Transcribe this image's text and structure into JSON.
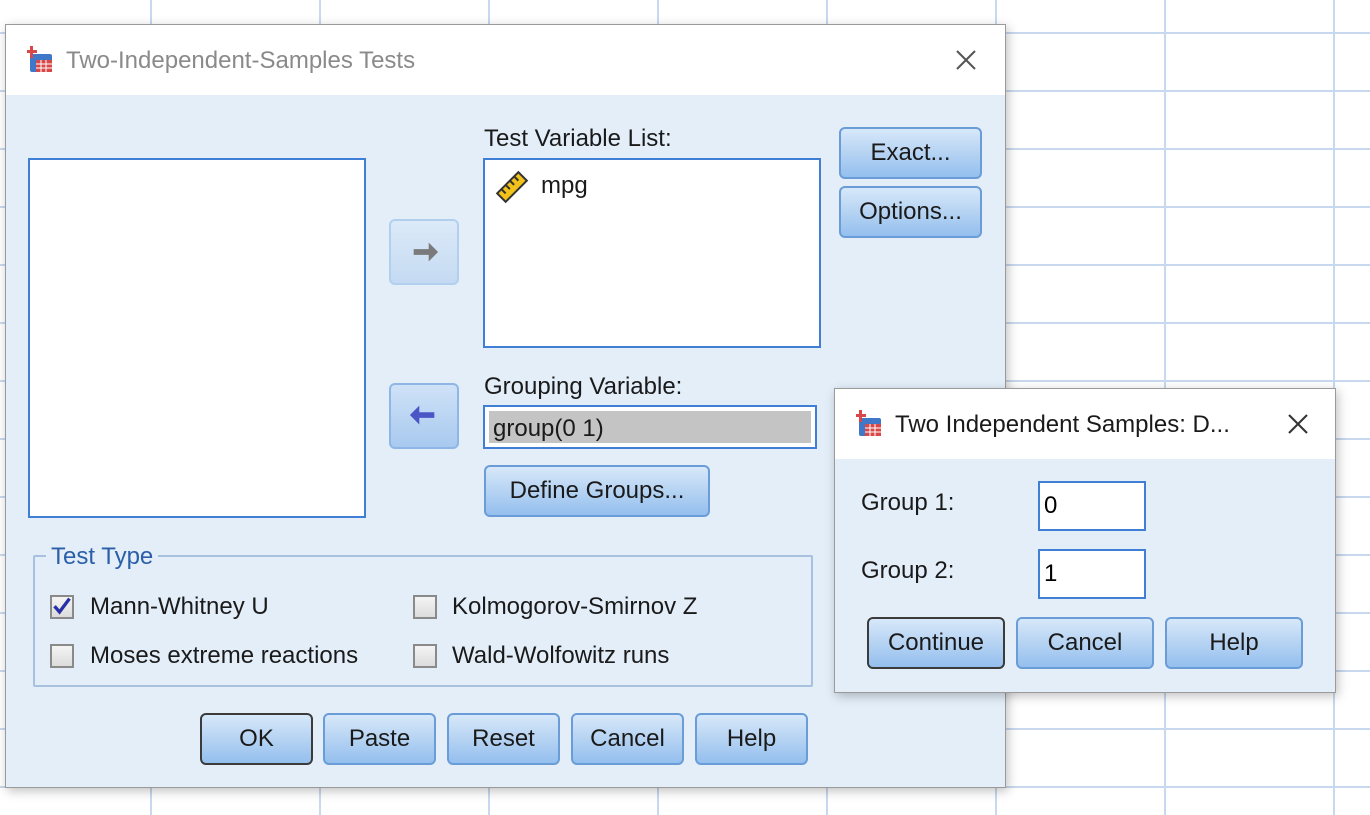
{
  "main_dialog": {
    "title": "Two-Independent-Samples Tests",
    "test_variable_list_label": "Test Variable List:",
    "test_variables": [
      {
        "name": "mpg",
        "icon": "scale-ruler-icon"
      }
    ],
    "grouping_variable_label": "Grouping Variable:",
    "grouping_variable_value": "group(0 1)",
    "define_groups_label": "Define Groups...",
    "exact_label": "Exact...",
    "options_label": "Options...",
    "test_type": {
      "legend": "Test Type",
      "mann_whitney": {
        "label": "Mann-Whitney U",
        "checked": true
      },
      "kolmogorov": {
        "label": "Kolmogorov-Smirnov Z",
        "checked": false
      },
      "moses": {
        "label": "Moses extreme reactions",
        "checked": false
      },
      "wald": {
        "label": "Wald-Wolfowitz runs",
        "checked": false
      }
    },
    "buttons": {
      "ok": "OK",
      "paste": "Paste",
      "reset": "Reset",
      "cancel": "Cancel",
      "help": "Help"
    }
  },
  "sub_dialog": {
    "title": "Two Independent Samples: D...",
    "group1_label": "Group 1:",
    "group1_value": "0",
    "group2_label": "Group 2:",
    "group2_value": "1",
    "buttons": {
      "continue": "Continue",
      "cancel": "Cancel",
      "help": "Help"
    }
  },
  "colors": {
    "dialog_bg": "#e3eef9",
    "accent_border": "#3f7fd6",
    "legend_text": "#2b5fa8"
  }
}
